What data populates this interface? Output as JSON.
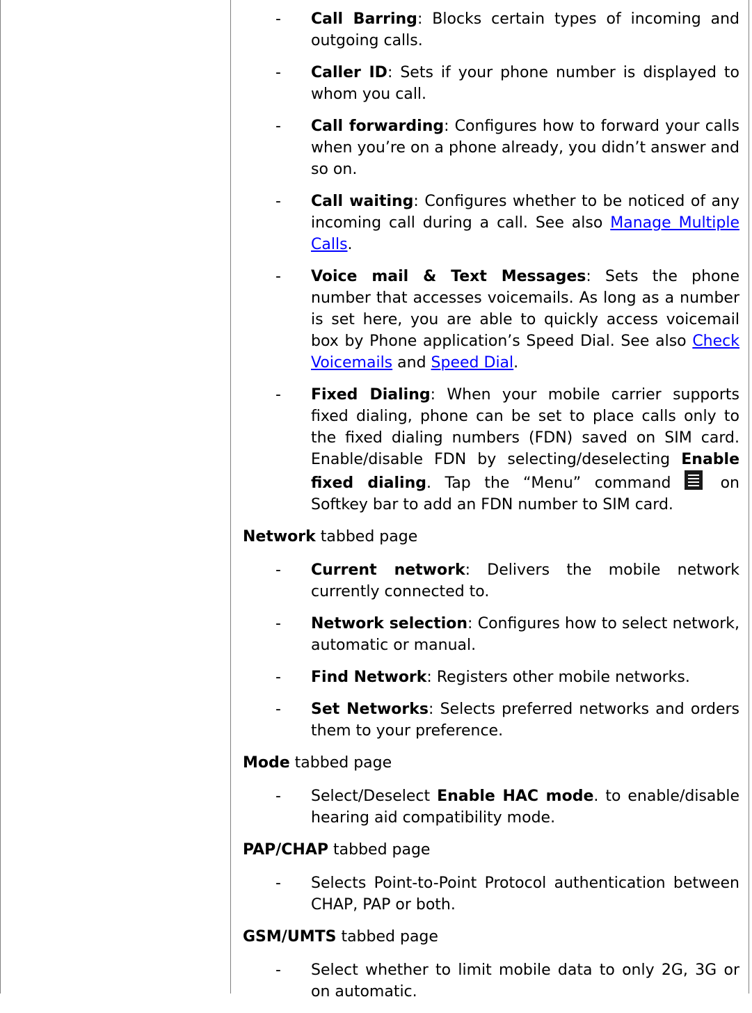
{
  "items_top": [
    {
      "title": "Call Barring",
      "text": ": Blocks certain types of incoming and outgoing calls."
    },
    {
      "title": "Caller ID",
      "text": ": Sets if your phone number is displayed to whom you call."
    },
    {
      "title": "Call forwarding",
      "text": ": Configures how to forward your calls when you’re on a phone already, you didn’t answer and so on."
    }
  ],
  "call_waiting": {
    "title": "Call waiting",
    "text": ": Configures whether to be noticed of any incoming call during a call. See also ",
    "link": "Manage Multiple Calls",
    "end": "."
  },
  "voice_mail": {
    "title": "Voice mail & Text Messages",
    "text": ": Sets the phone number that accesses voicemails. As long as a number is set here, you are able to quickly access voicemail box by Phone application’s Speed Dial. See also ",
    "link1": "Check Voicemails",
    "and": " and ",
    "link2": "Speed Dial",
    "end": "."
  },
  "fixed_dialing": {
    "title": "Fixed Dialing",
    "text1": ": When your mobile carrier supports fixed dialing, phone can be set to place calls only to the fixed dialing numbers (FDN) saved on SIM card. Enable/disable FDN by selecting/deselecting ",
    "bold": "Enable fixed dialing",
    "text2": ". Tap the “Menu” command ",
    "icon": "menu-icon",
    "text3": " on Softkey bar to add an FDN number to SIM card."
  },
  "network": {
    "heading": "Network",
    "heading_suffix": " tabbed page",
    "items": [
      {
        "title": "Current network",
        "text": ": Delivers the mobile network currently connected to."
      },
      {
        "title": "Network selection",
        "text": ": Configures how to select network, automatic or manual."
      },
      {
        "title": "Find Network",
        "text": ": Registers other mobile networks."
      },
      {
        "title": "Set Networks",
        "text": ": Selects preferred networks and orders them to your preference."
      }
    ]
  },
  "mode": {
    "heading": "Mode",
    "heading_suffix": " tabbed page",
    "pre": "Select/Deselect ",
    "bold": "Enable HAC mode",
    "post": ". to enable/disable hearing aid compatibility mode."
  },
  "pap": {
    "heading": "PAP/CHAP",
    "heading_suffix": " tabbed page",
    "text": "Selects Point-to-Point Protocol authentication between CHAP, PAP or both."
  },
  "gsm": {
    "heading": "GSM/UMTS",
    "heading_suffix": " tabbed page",
    "text": "Select whether to limit mobile data to only 2G, 3G or on automatic."
  },
  "dash": "-"
}
